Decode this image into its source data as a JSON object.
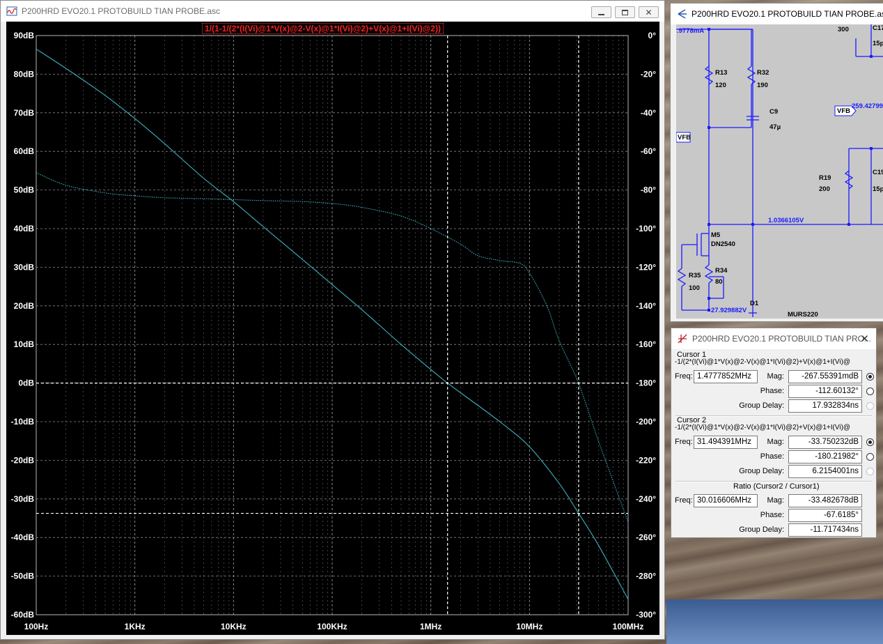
{
  "colors": {
    "trace": "#3fb0bf",
    "grid": "#b8b8b8",
    "axis_text": "#ffffff",
    "title_red": "#ff2020",
    "wire": "#1a1aff",
    "schematic_bg": "#c8c8c8"
  },
  "plot_window": {
    "title": "P200HRD EVO20.1 PROTOBUILD TIAN PROBE.asc",
    "trace_expression": "1/(1-1/(2*(I(Vi)@1*V(x)@2-V(x)@1*I(Vi)@2)+V(x)@1+I(Vi)@2))",
    "icons": [
      "waveform-icon",
      "minimize-icon",
      "restore-icon",
      "close-icon"
    ]
  },
  "chart_data": {
    "type": "line",
    "xscale": "log",
    "xlim": [
      100,
      100000000
    ],
    "x_ticks": [
      "100Hz",
      "1KHz",
      "10KHz",
      "100KHz",
      "1MHz",
      "10MHz",
      "100MHz"
    ],
    "ylim_left": [
      -60,
      90
    ],
    "y_ticks_left": [
      "90dB",
      "80dB",
      "70dB",
      "60dB",
      "50dB",
      "40dB",
      "30dB",
      "20dB",
      "10dB",
      "0dB",
      "-10dB",
      "-20dB",
      "-30dB",
      "-40dB",
      "-50dB",
      "-60dB"
    ],
    "ylim_right": [
      -300,
      0
    ],
    "y_ticks_right": [
      "0°",
      "-20°",
      "-40°",
      "-60°",
      "-80°",
      "-100°",
      "-120°",
      "-140°",
      "-160°",
      "-180°",
      "-200°",
      "-220°",
      "-240°",
      "-260°",
      "-280°",
      "-300°"
    ],
    "grid": true,
    "series": [
      {
        "axis": "left",
        "style": "solid",
        "x": [
          100,
          200,
          500,
          1000,
          2000,
          5000,
          10000,
          20000,
          50000,
          100000,
          200000,
          500000,
          1000000,
          1477785,
          2000000,
          5000000,
          10000000,
          20000000,
          31494391,
          50000000,
          100000000
        ],
        "y": [
          86.5,
          81.5,
          74.5,
          68.5,
          62,
          53,
          47,
          40.5,
          32,
          25.5,
          19,
          10,
          3.5,
          0,
          -2.5,
          -10,
          -16.5,
          -26,
          -33.75,
          -42,
          -56
        ]
      },
      {
        "axis": "right",
        "style": "dotted",
        "x": [
          100,
          200,
          500,
          1000,
          2000,
          5000,
          10000,
          20000,
          50000,
          100000,
          200000,
          500000,
          1000000,
          2000000,
          3000000,
          5000000,
          8000000,
          10000000,
          15000000,
          20000000,
          31494391,
          50000000,
          100000000
        ],
        "y": [
          -71,
          -77.5,
          -81.5,
          -83,
          -84,
          -84.5,
          -85,
          -85.5,
          -86,
          -87,
          -89,
          -93.5,
          -100,
          -108,
          -114,
          -116.5,
          -118,
          -123,
          -140,
          -158,
          -180.2,
          -210,
          -252
        ]
      }
    ],
    "cursors": [
      {
        "name": "Cursor 1",
        "x": 1477785.2,
        "y_db": 0
      },
      {
        "name": "Cursor 2",
        "x": 31494391,
        "y_db": -33.75
      }
    ]
  },
  "schematic_window": {
    "title": "P200HRD EVO20.1 PROTOBUILD TIAN PROBE.asc",
    "labels": {
      "i_top": ".9778mA",
      "r13": "R13",
      "r13v": "120",
      "r32": "R32",
      "r32v": "190",
      "c9": "C9",
      "c9v": "47µ",
      "vfb_left": "VFB",
      "vfb_right": "VFB",
      "vfb_val": "259.42799",
      "r19": "R19",
      "r19v": "200",
      "c17": "C17",
      "c17v": "15p",
      "c19": "C19",
      "c19v": "15p",
      "r_top": "300",
      "node_v": "1.0366105V",
      "m5": "M5",
      "m5v": "DN2540",
      "r35": "R35",
      "r35v": "100",
      "r34": "R34",
      "r34v": "80",
      "d1": "D1",
      "d1v": "MURS220",
      "v_bottom": "27.929882V"
    }
  },
  "cursor_window": {
    "title": "P200HRD EVO20.1 PROTOBUILD TIAN PRO...",
    "cursor1": {
      "label": "Cursor 1",
      "expression": "-1/(2*(I(Vi)@1*V(x)@2-V(x)@1*I(Vi)@2)+V(x)@1+I(Vi)@",
      "freq_label": "Freq:",
      "freq": "1.4777852MHz",
      "mag_label": "Mag:",
      "mag": "-267.55391mdB",
      "phase_label": "Phase:",
      "phase": "-112.60132°",
      "gd_label": "Group Delay:",
      "gd": "17.932834ns"
    },
    "cursor2": {
      "label": "Cursor 2",
      "expression": "-1/(2*(I(Vi)@1*V(x)@2-V(x)@1*I(Vi)@2)+V(x)@1+I(Vi)@",
      "freq_label": "Freq:",
      "freq": "31.494391MHz",
      "mag_label": "Mag:",
      "mag": "-33.750232dB",
      "phase_label": "Phase:",
      "phase": "-180.21982°",
      "gd_label": "Group Delay:",
      "gd": "6.2154001ns"
    },
    "ratio": {
      "label": "Ratio (Cursor2 / Cursor1)",
      "freq_label": "Freq:",
      "freq": "30.016606MHz",
      "mag_label": "Mag:",
      "mag": "-33.482678dB",
      "phase_label": "Phase:",
      "phase": "-67.6185°",
      "gd_label": "Group Delay:",
      "gd": "-11.717434ns"
    }
  }
}
